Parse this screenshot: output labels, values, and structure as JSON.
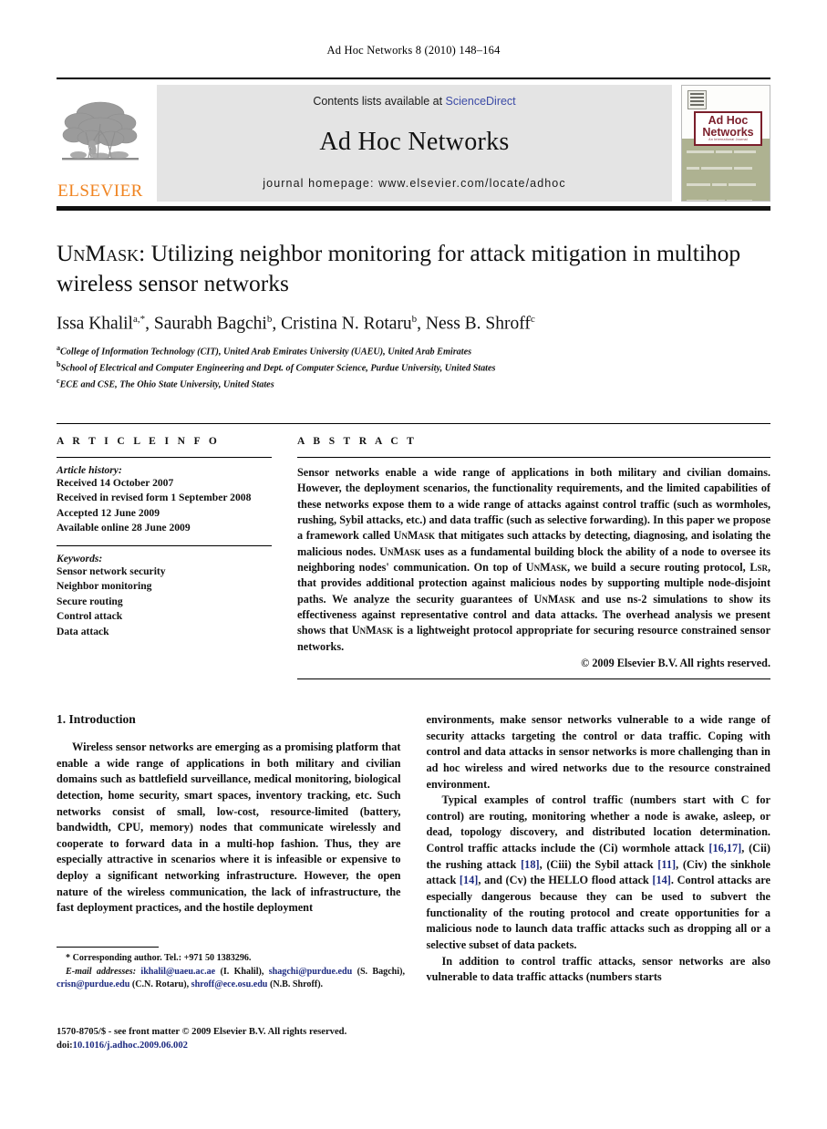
{
  "running_head": "Ad Hoc Networks 8 (2010) 148–164",
  "banner": {
    "publisher_word": "ELSEVIER",
    "contents_prefix": "Contents lists available at ",
    "contents_link": "ScienceDirect",
    "journal_name": "Ad Hoc Networks",
    "homepage": "journal homepage: www.elsevier.com/locate/adhoc",
    "cover": {
      "title_line1": "Ad Hoc",
      "title_line2": "Networks",
      "subtitle": "An International Journal"
    }
  },
  "article": {
    "title_smallcaps": "UnMask",
    "title_rest": ": Utilizing neighbor monitoring for attack mitigation in multihop wireless sensor networks",
    "authors": "Issa Khalil a,*, Saurabh Bagchi b, Cristina N. Rotaru b, Ness B. Shroff c",
    "affiliations": [
      "a College of Information Technology (CIT), United Arab Emirates University (UAEU), United Arab Emirates",
      "b School of Electrical and Computer Engineering and Dept. of Computer Science, Purdue University, United States",
      "c ECE and CSE, The Ohio State University, United States"
    ]
  },
  "article_info": {
    "heading": "A R T I C L E    I N F O",
    "history_label": "Article history:",
    "history": [
      "Received 14 October 2007",
      "Received in revised form 1 September 2008",
      "Accepted 12 June 2009",
      "Available online 28 June 2009"
    ],
    "keywords_label": "Keywords:",
    "keywords": [
      "Sensor network security",
      "Neighbor monitoring",
      "Secure routing",
      "Control attack",
      "Data attack"
    ]
  },
  "abstract": {
    "heading": "A B S T R A C T",
    "text": "Sensor networks enable a wide range of applications in both military and civilian domains. However, the deployment scenarios, the functionality requirements, and the limited capabilities of these networks expose them to a wide range of attacks against control traffic (such as wormholes, rushing, Sybil attacks, etc.) and data traffic (such as selective forwarding). In this paper we propose a framework called UnMask that mitigates such attacks by detecting, diagnosing, and isolating the malicious nodes. UnMask uses as a fundamental building block the ability of a node to oversee its neighboring nodes' communication. On top of UnMask, we build a secure routing protocol, Lsr, that provides additional protection against malicious nodes by supporting multiple node-disjoint paths. We analyze the security guarantees of UnMask and use ns-2 simulations to show its effectiveness against representative control and data attacks. The overhead analysis we present shows that UnMask is a lightweight protocol appropriate for securing resource constrained sensor networks.",
    "copyright": "© 2009 Elsevier B.V. All rights reserved."
  },
  "body": {
    "section_title": "1. Introduction",
    "left_paragraphs": [
      "Wireless sensor networks are emerging as a promising platform that enable a wide range of applications in both military and civilian domains such as battlefield surveillance, medical monitoring, biological detection, home security, smart spaces, inventory tracking, etc. Such networks consist of small, low-cost, resource-limited (battery, bandwidth, CPU, memory) nodes that communicate wirelessly and cooperate to forward data in a multi-hop fashion. Thus, they are especially attractive in scenarios where it is infeasible or expensive to deploy a significant networking infrastructure. However, the open nature of the wireless communication, the lack of infrastructure, the fast deployment practices, and the hostile deployment"
    ],
    "right_paragraph_1": "environments, make sensor networks vulnerable to a wide range of security attacks targeting the control or data traffic. Coping with control and data attacks in sensor networks is more challenging than in ad hoc wireless and wired networks due to the resource constrained environment.",
    "right_paragraph_2_parts": [
      "Typical examples of control traffic (numbers start with C for control) are routing, monitoring whether a node is awake, asleep, or dead, topology discovery, and distributed location determination. Control traffic attacks include the (Ci) wormhole attack ",
      "[16,17]",
      ", (Cii) the rushing attack ",
      "[18]",
      ", (Ciii) the Sybil attack ",
      "[11]",
      ", (Civ) the sinkhole attack ",
      "[14]",
      ", and (Cv) the HELLO flood attack ",
      "[14]",
      ". Control attacks are especially dangerous because they can be used to subvert the functionality of the routing protocol and create opportunities for a malicious node to launch data traffic attacks such as dropping all or a selective subset of data packets."
    ],
    "right_paragraph_3": "In addition to control traffic attacks, sensor networks are also vulnerable to data traffic attacks (numbers starts"
  },
  "footnote": {
    "corresponding": "Corresponding author. Tel.: +971 50 1383296.",
    "email_label": "E-mail addresses:",
    "emails": [
      {
        "address": "ikhalil@uaeu.ac.ae",
        "name": "(I. Khalil)"
      },
      {
        "address": "shagchi@purdue.edu",
        "name": "(S. Bagchi)"
      },
      {
        "address": "crisn@purdue.edu",
        "name": "(C.N. Rotaru)"
      },
      {
        "address": "shroff@ece.osu.edu",
        "name": "(N.B. Shroff)."
      }
    ]
  },
  "issn": {
    "line1": "1570-8705/$ - see front matter © 2009 Elsevier B.V. All rights reserved.",
    "doi_prefix": "doi:",
    "doi": "10.1016/j.adhoc.2009.06.002"
  }
}
